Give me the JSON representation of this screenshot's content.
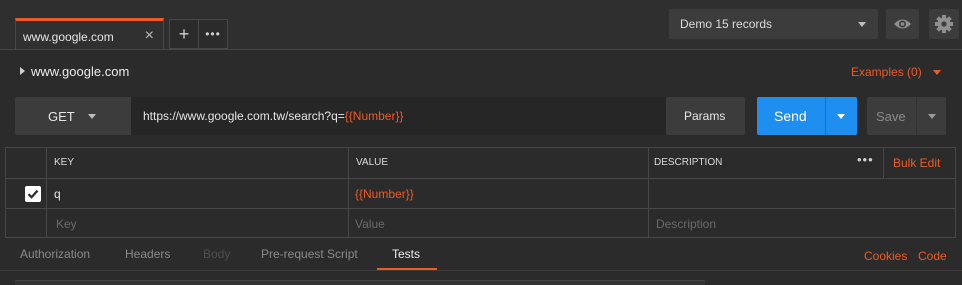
{
  "tabs": [
    {
      "label": "www.google.com",
      "close": "×"
    }
  ],
  "tab_actions": {
    "add": "+",
    "more": "•••"
  },
  "environment": {
    "selected": "Demo 15 records"
  },
  "request": {
    "name": "www.google.com",
    "examples": "Examples (0)"
  },
  "url_bar": {
    "method": "GET",
    "url_prefix": "https://www.google.com.tw/search?q=",
    "url_variable": "{{Number}}",
    "params_label": "Params",
    "send_label": "Send",
    "save_label": "Save"
  },
  "params_table": {
    "headers": {
      "key": "KEY",
      "value": "VALUE",
      "description": "DESCRIPTION"
    },
    "more": "•••",
    "bulk_edit": "Bulk Edit",
    "rows": [
      {
        "checked": true,
        "key": "q",
        "value": "{{Number}}",
        "description": ""
      }
    ],
    "placeholders": {
      "key": "Key",
      "value": "Value",
      "description": "Description"
    }
  },
  "subtabs": [
    {
      "label": "Authorization",
      "state": "dim"
    },
    {
      "label": "Headers",
      "state": "dim"
    },
    {
      "label": "Body",
      "state": "disabled"
    },
    {
      "label": "Pre-request Script",
      "state": "dim"
    },
    {
      "label": "Tests",
      "state": "active"
    }
  ],
  "right_links": {
    "cookies": "Cookies",
    "code": "Code"
  },
  "colors": {
    "accent": "#ef5b25",
    "send": "#1f8ef1",
    "background": "#2b2b2b"
  }
}
